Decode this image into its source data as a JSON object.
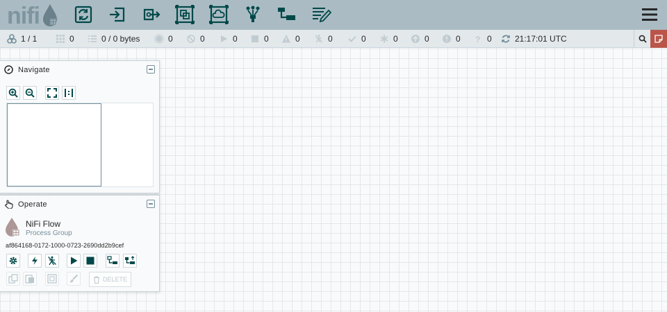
{
  "header": {
    "logo": "nifi",
    "toolbar_items": [
      "processor",
      "input-port",
      "output-port",
      "process-group",
      "remote-process-group",
      "funnel",
      "template",
      "label"
    ]
  },
  "status": {
    "threads": "1 / 1",
    "queued_count": "0",
    "queued_bytes": "0 / 0 bytes",
    "transmitting": "0",
    "not_transmitting": "0",
    "running": "0",
    "stopped": "0",
    "invalid": "0",
    "disabled": "0",
    "up_to_date": "0",
    "locally_modified": "0",
    "stale": "0",
    "locally_modified_stale": "0",
    "sync_failure": "0",
    "last_refreshed": "21:17:01 UTC"
  },
  "navigate": {
    "title": "Navigate"
  },
  "operate": {
    "title": "Operate",
    "component_name": "NiFi Flow",
    "component_type": "Process Group",
    "component_id": "af864168-0172-1000-0723-2690dd2b9cef",
    "delete_label": "DELETE"
  },
  "colors": {
    "header_bg": "#aabbc3",
    "icon_dark": "#004849",
    "bulletin": "#ba554a",
    "status_bg": "#e3e8eb"
  }
}
